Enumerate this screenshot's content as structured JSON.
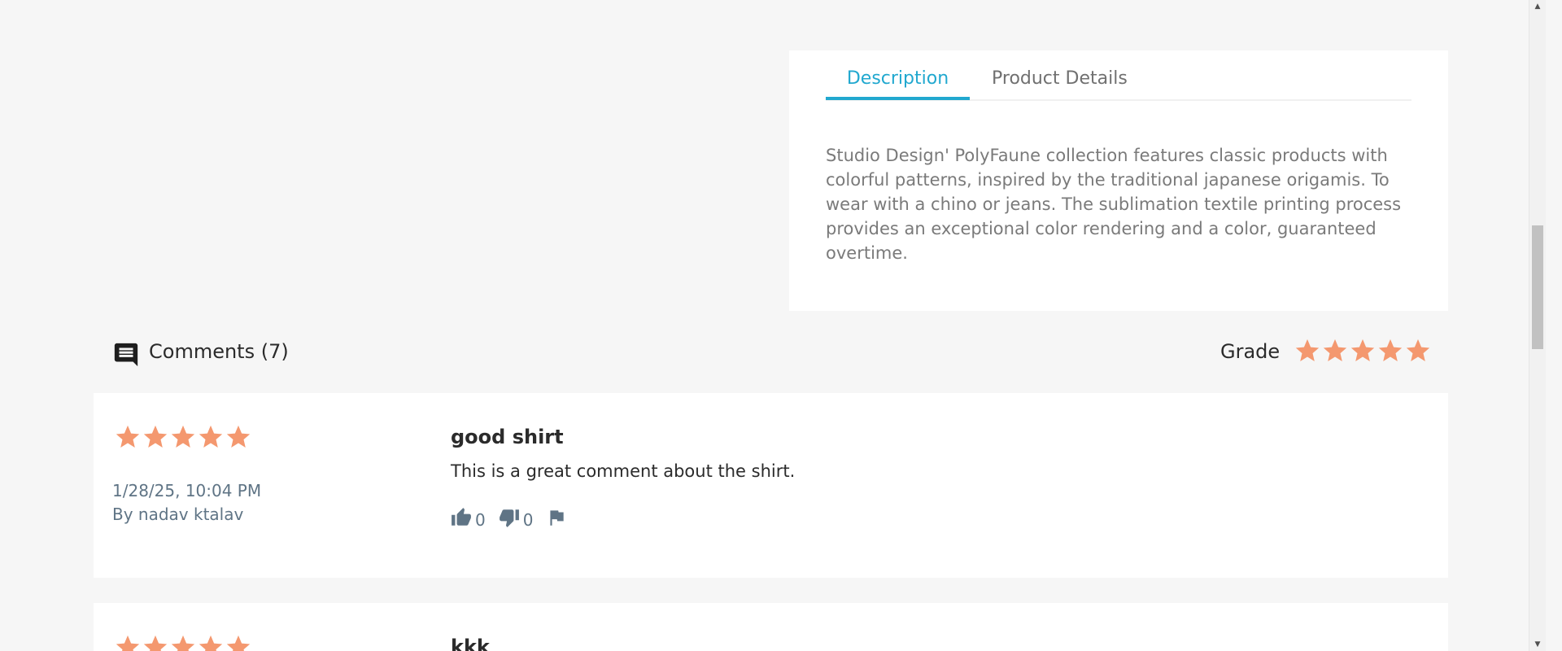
{
  "tabs": {
    "description": "Description",
    "details": "Product Details"
  },
  "description": {
    "text": "Studio Design' PolyFaune collection features classic products with colorful patterns, inspired by the traditional japanese origamis. To wear with a chino or jeans. The sublimation textile printing process provides an exceptional color rendering and a color, guaranteed overtime."
  },
  "comments": {
    "title": "Comments (7)",
    "grade_label": "Grade",
    "grade_stars": 5,
    "items": [
      {
        "stars": 5,
        "date": "1/28/25, 10:04 PM",
        "author": "By nadav ktalav",
        "title": "good shirt",
        "body": "This is a great comment about the shirt.",
        "likes": "0",
        "dislikes": "0"
      },
      {
        "stars": 5,
        "title": "kkk"
      }
    ]
  },
  "colors": {
    "accent": "#21a8cf",
    "star": "#f4986f",
    "meta_text": "#5f7485"
  },
  "icons": {
    "comment": "comment-icon",
    "star": "star-icon",
    "like": "thumbs-up-icon",
    "dislike": "thumbs-down-icon",
    "flag": "flag-icon"
  }
}
